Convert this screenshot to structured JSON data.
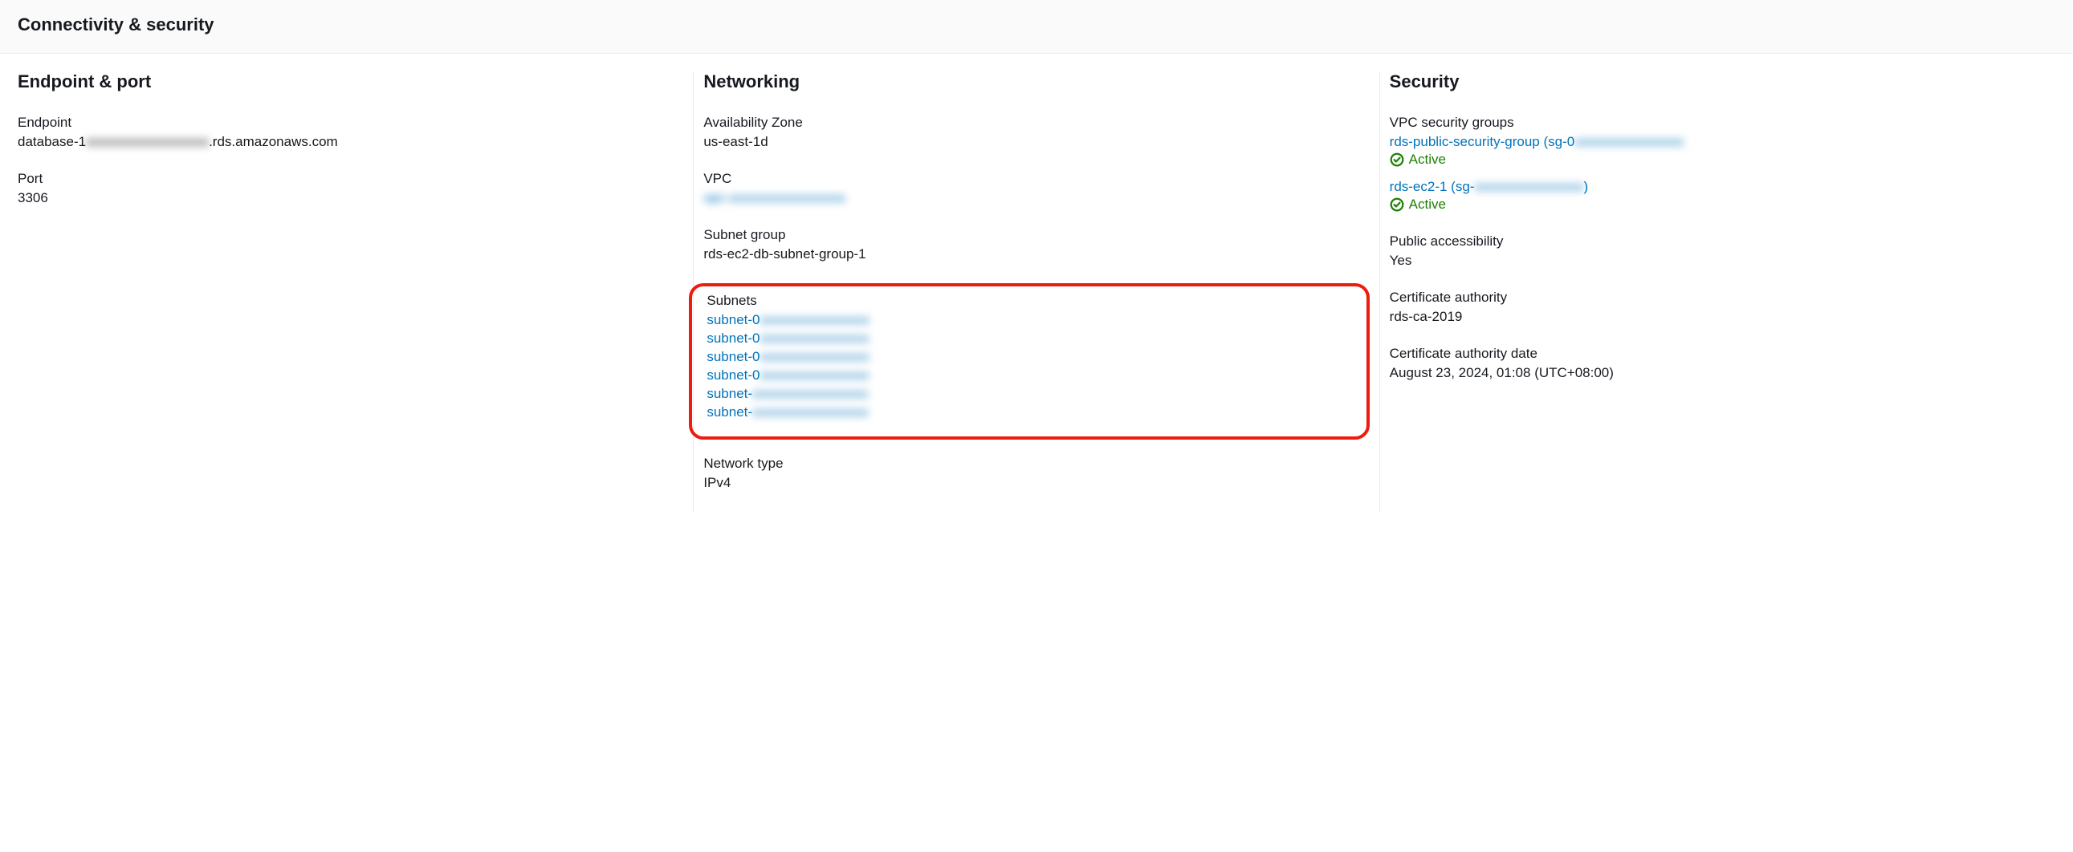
{
  "header": {
    "title": "Connectivity & security"
  },
  "endpoint_port": {
    "heading": "Endpoint & port",
    "endpoint_label": "Endpoint",
    "endpoint_prefix": "database-1",
    "endpoint_blurred": "xxxxxxxxxxxxxxxxxx",
    "endpoint_suffix": ".rds.amazonaws.com",
    "port_label": "Port",
    "port_value": "3306"
  },
  "networking": {
    "heading": "Networking",
    "az_label": "Availability Zone",
    "az_value": "us-east-1d",
    "vpc_label": "VPC",
    "vpc_value_blurred": "vpc-xxxxxxxxxxxxxxxxx",
    "subnet_group_label": "Subnet group",
    "subnet_group_value": "rds-ec2-db-subnet-group-1",
    "subnets_label": "Subnets",
    "subnets": [
      {
        "prefix": "subnet-0",
        "blur": "xxxxxxxxxxxxxxxx"
      },
      {
        "prefix": "subnet-0",
        "blur": "xxxxxxxxxxxxxxxx"
      },
      {
        "prefix": "subnet-0",
        "blur": "xxxxxxxxxxxxxxxx"
      },
      {
        "prefix": "subnet-0",
        "blur": "xxxxxxxxxxxxxxxx"
      },
      {
        "prefix": "subnet-",
        "blur": "xxxxxxxxxxxxxxxxx"
      },
      {
        "prefix": "subnet-",
        "blur": "xxxxxxxxxxxxxxxxx"
      }
    ],
    "network_type_label": "Network type",
    "network_type_value": "IPv4"
  },
  "security": {
    "heading": "Security",
    "vpc_sg_label": "VPC security groups",
    "security_groups": [
      {
        "name_prefix": "rds-public-security-group (sg-0",
        "blur": "xxxxxxxxxxxxxxxx",
        "suffix": "",
        "status": "Active"
      },
      {
        "name_prefix": "rds-ec2-1 (sg-",
        "blur": "xxxxxxxxxxxxxxxx",
        "suffix": ")",
        "status": "Active"
      }
    ],
    "public_accessibility_label": "Public accessibility",
    "public_accessibility_value": "Yes",
    "ca_label": "Certificate authority",
    "ca_value": "rds-ca-2019",
    "ca_date_label": "Certificate authority date",
    "ca_date_value": "August 23, 2024, 01:08 (UTC+08:00)"
  }
}
